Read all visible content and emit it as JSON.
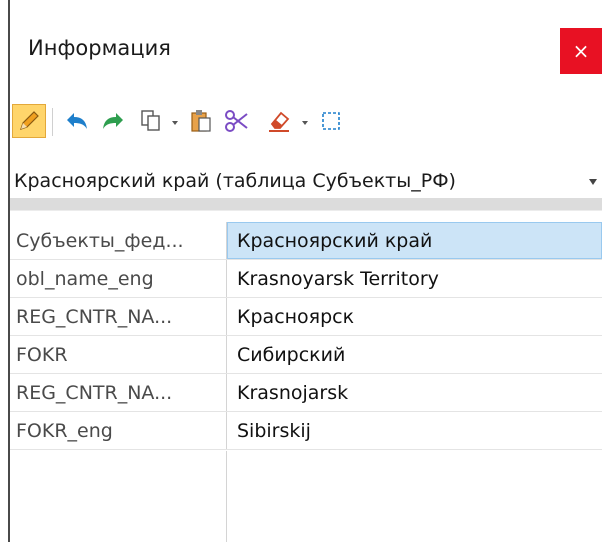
{
  "window": {
    "title": "Информация",
    "close_glyph": "×"
  },
  "toolbar": {
    "icons": [
      "pencil-icon",
      "undo-icon",
      "redo-icon",
      "copy-icon",
      "paste-icon",
      "cut-icon",
      "eraser-icon",
      "select-rectangle-icon"
    ],
    "colors": {
      "active_bg": "#ffd56b",
      "undo": "#1e7fcb",
      "redo": "#2e9e4f",
      "cut": "#7b4cc4",
      "eraser": "#d04a2a"
    }
  },
  "selector": {
    "selected_value": "Красноярский край (таблица Субъекты_РФ)"
  },
  "attributes": [
    {
      "key": "Субъекты_фед...",
      "value": "Красноярский край"
    },
    {
      "key": "obl_name_eng",
      "value": "Krasnoyarsk Territory"
    },
    {
      "key": "REG_CNTR_NA...",
      "value": "Красноярск"
    },
    {
      "key": "FOKR",
      "value": "Сибирский"
    },
    {
      "key": "REG_CNTR_NA...",
      "value": "Krasnojarsk"
    },
    {
      "key": "FOKR_eng",
      "value": "Sibirskij"
    }
  ]
}
